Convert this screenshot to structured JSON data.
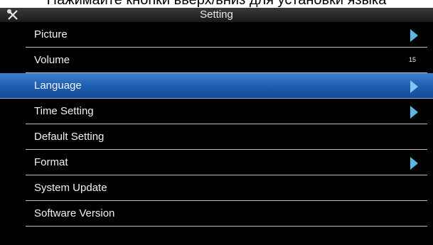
{
  "caption": "Нажимайте кнопки вверх/вниз для установки языка",
  "window": {
    "title": "Setting",
    "icon": "tools-icon"
  },
  "menu": {
    "items": [
      {
        "label": "Picture",
        "has_arrow": true
      },
      {
        "label": "Volume",
        "value": "15"
      },
      {
        "label": "Language",
        "has_arrow": true,
        "selected": true
      },
      {
        "label": "Time Setting",
        "has_arrow": true
      },
      {
        "label": "Default Setting"
      },
      {
        "label": "Format",
        "has_arrow": true
      },
      {
        "label": "System Update"
      },
      {
        "label": "Software Version"
      }
    ]
  },
  "colors": {
    "highlight": "#1d5cae",
    "arrow": "#5ab8e0",
    "background": "#000000"
  }
}
